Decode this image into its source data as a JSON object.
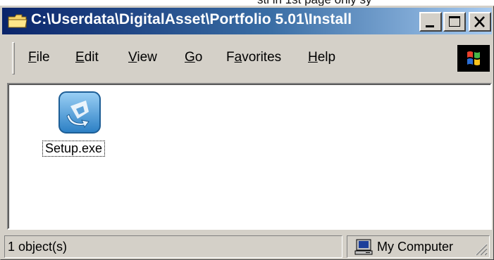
{
  "window": {
    "title": "C:\\Userdata\\DigitalAsset\\Portfolio 5.01\\Install"
  },
  "background_text": "sti in 1st page only sy",
  "menu": {
    "items": [
      {
        "accel": "F",
        "rest": "ile"
      },
      {
        "accel": "E",
        "rest": "dit"
      },
      {
        "accel": "V",
        "rest": "iew"
      },
      {
        "accel": "G",
        "rest": "o"
      },
      {
        "pre": "F",
        "accel": "a",
        "rest": "vorites"
      },
      {
        "accel": "H",
        "rest": "elp"
      }
    ]
  },
  "files": [
    {
      "name": "Setup.exe",
      "icon": "setup-installer-icon"
    }
  ],
  "status": {
    "count": "1 object(s)",
    "zone": "My Computer",
    "zone_icon": "my-computer-icon"
  },
  "colors": {
    "title_start": "#0a246a",
    "title_end": "#a6caf0",
    "face": "#d4d0c8"
  }
}
